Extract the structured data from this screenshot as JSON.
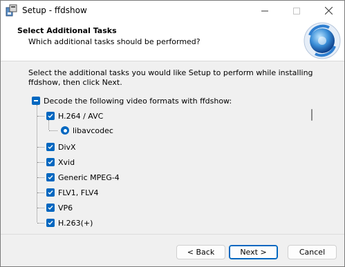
{
  "window": {
    "title": "Setup - ffdshow"
  },
  "header": {
    "title": "Select Additional Tasks",
    "subtitle": "Which additional tasks should be performed?"
  },
  "instruction": "Select the additional tasks you would like Setup to perform while installing ffdshow, then click Next.",
  "tasks": {
    "group_label": "Decode the following video formats with ffdshow:",
    "group_state": "partial",
    "items": [
      {
        "label": "H.264 / AVC",
        "checked": true
      },
      {
        "label": "libavcodec",
        "type": "radio",
        "selected": true
      },
      {
        "label": "DivX",
        "checked": true
      },
      {
        "label": "Xvid",
        "checked": true
      },
      {
        "label": "Generic MPEG-4",
        "checked": true
      },
      {
        "label": "FLV1, FLV4",
        "checked": true
      },
      {
        "label": "VP6",
        "checked": true
      },
      {
        "label": "H.263(+)",
        "checked": true
      }
    ]
  },
  "buttons": {
    "back": "< Back",
    "next": "Next >",
    "cancel": "Cancel"
  },
  "colors": {
    "accent": "#0067c0"
  }
}
